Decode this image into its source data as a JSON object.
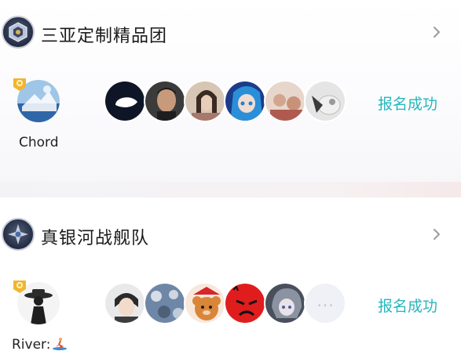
{
  "teams": [
    {
      "name": "三亚定制精品团",
      "leader_name": "Chord",
      "status": "报名成功",
      "member_count": 6
    },
    {
      "name": "真银河战舰队",
      "leader_name": "River:",
      "status": "报名成功",
      "member_count": 6,
      "more_slot": "…"
    }
  ],
  "colors": {
    "status": "#25b7bd",
    "title": "#1a1a1a"
  },
  "icons": [
    "team-emblem-icon",
    "chevron-right-icon",
    "crown-badge-icon",
    "surfer-emoji-icon"
  ]
}
